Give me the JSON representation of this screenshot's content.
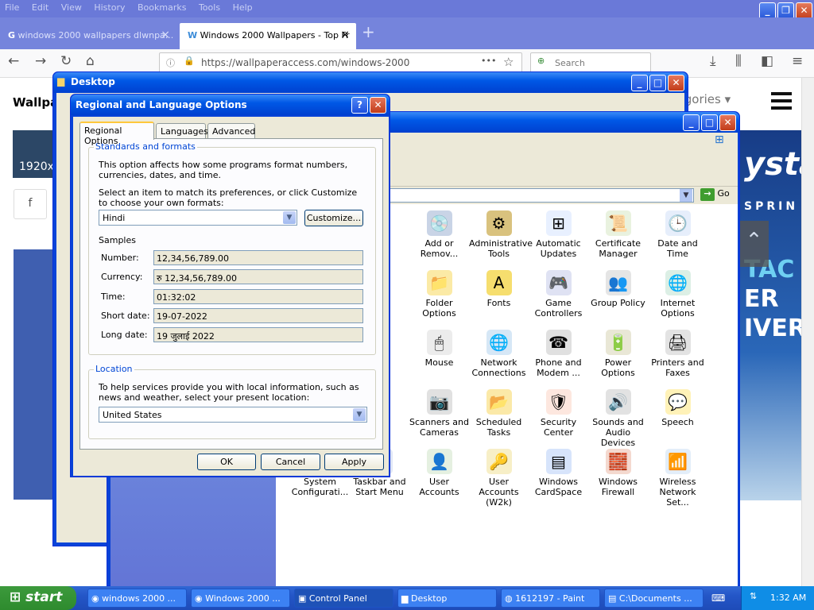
{
  "browser": {
    "menu": [
      "File",
      "Edit",
      "View",
      "History",
      "Bookmarks",
      "Tools",
      "Help"
    ],
    "tabs": [
      {
        "title": "windows 2000 wallpapers dlwnpa..."
      },
      {
        "title": "Windows 2000 Wallpapers - Top Fr"
      }
    ],
    "url": "https://wallpaperaccess.com/windows-2000",
    "search_placeholder": "Search",
    "page": {
      "logo": "Wallpa",
      "resolution": "1920x1",
      "categories": "Categories",
      "ad": {
        "t1": "ysta",
        "t2": "SPRIN",
        "t3": "TAC",
        "t4": "ER",
        "t5": "IVER"
      }
    }
  },
  "desktop_window": {
    "title": "Desktop"
  },
  "control_panel": {
    "go_label": "Go",
    "icons": [
      {
        "label": "Add or Remov...",
        "icon": "cd-install-icon"
      },
      {
        "label": "Administrative Tools",
        "icon": "admin-tools-icon"
      },
      {
        "label": "Automatic Updates",
        "icon": "windows-flag-icon"
      },
      {
        "label": "Certificate Manager",
        "icon": "certificate-icon"
      },
      {
        "label": "Date and Time",
        "icon": "clock-icon"
      },
      {
        "label": "Folder Options",
        "icon": "folder-icon"
      },
      {
        "label": "Fonts",
        "icon": "fonts-folder-icon"
      },
      {
        "label": "Game Controllers",
        "icon": "gamepad-icon"
      },
      {
        "label": "Group Policy",
        "icon": "users-icon"
      },
      {
        "label": "Internet Options",
        "icon": "globe-icon"
      },
      {
        "label": "Mouse",
        "icon": "mouse-icon"
      },
      {
        "label": "Network Connections",
        "icon": "network-icon"
      },
      {
        "label": "Phone and Modem ...",
        "icon": "phone-icon"
      },
      {
        "label": "Power Options",
        "icon": "power-icon"
      },
      {
        "label": "Printers and Faxes",
        "icon": "printer-icon"
      },
      {
        "label": "Scanners and Cameras",
        "icon": "scanner-icon"
      },
      {
        "label": "Scheduled Tasks",
        "icon": "tasks-folder-icon"
      },
      {
        "label": "Security Center",
        "icon": "shield-icon"
      },
      {
        "label": "Sounds and Audio Devices",
        "icon": "speaker-icon"
      },
      {
        "label": "Speech",
        "icon": "speech-icon"
      },
      {
        "label": "System Configurati...",
        "icon": "system-icon"
      },
      {
        "label": "Taskbar and Start Menu",
        "icon": "taskbar-icon"
      },
      {
        "label": "User Accounts",
        "icon": "user-accounts-icon"
      },
      {
        "label": "User Accounts (W2k)",
        "icon": "key-user-icon"
      },
      {
        "label": "Windows CardSpace",
        "icon": "cardspace-icon"
      },
      {
        "label": "Windows Firewall",
        "icon": "firewall-icon"
      },
      {
        "label": "Wireless Network Set...",
        "icon": "wireless-icon"
      }
    ]
  },
  "regional_dialog": {
    "title": "Regional and Language Options",
    "tabs": [
      "Regional Options",
      "Languages",
      "Advanced"
    ],
    "standards_group": "Standards and formats",
    "standards_desc": "This option affects how some programs format numbers, currencies, dates, and time.",
    "select_desc": "Select an item to match its preferences, or click Customize to choose your own formats:",
    "format_value": "Hindi",
    "customize_label": "Customize...",
    "samples_label": "Samples",
    "samples": [
      {
        "label": "Number:",
        "value": "12,34,56,789.00"
      },
      {
        "label": "Currency:",
        "value": "रु 12,34,56,789.00"
      },
      {
        "label": "Time:",
        "value": "01:32:02"
      },
      {
        "label": "Short date:",
        "value": "19-07-2022"
      },
      {
        "label": "Long date:",
        "value": "19 जुलाई 2022"
      }
    ],
    "location_group": "Location",
    "location_desc": "To help services provide you with local information, such as news and weather, select your present location:",
    "location_value": "United States",
    "ok": "OK",
    "cancel": "Cancel",
    "apply": "Apply"
  },
  "taskbar": {
    "start": "start",
    "tasks": [
      {
        "label": "windows 2000 ..."
      },
      {
        "label": "Windows 2000 ..."
      },
      {
        "label": "Control Panel"
      },
      {
        "label": "Desktop"
      },
      {
        "label": "1612197 - Paint"
      },
      {
        "label": "C:\\Documents ..."
      }
    ],
    "clock": "1:32 AM"
  }
}
